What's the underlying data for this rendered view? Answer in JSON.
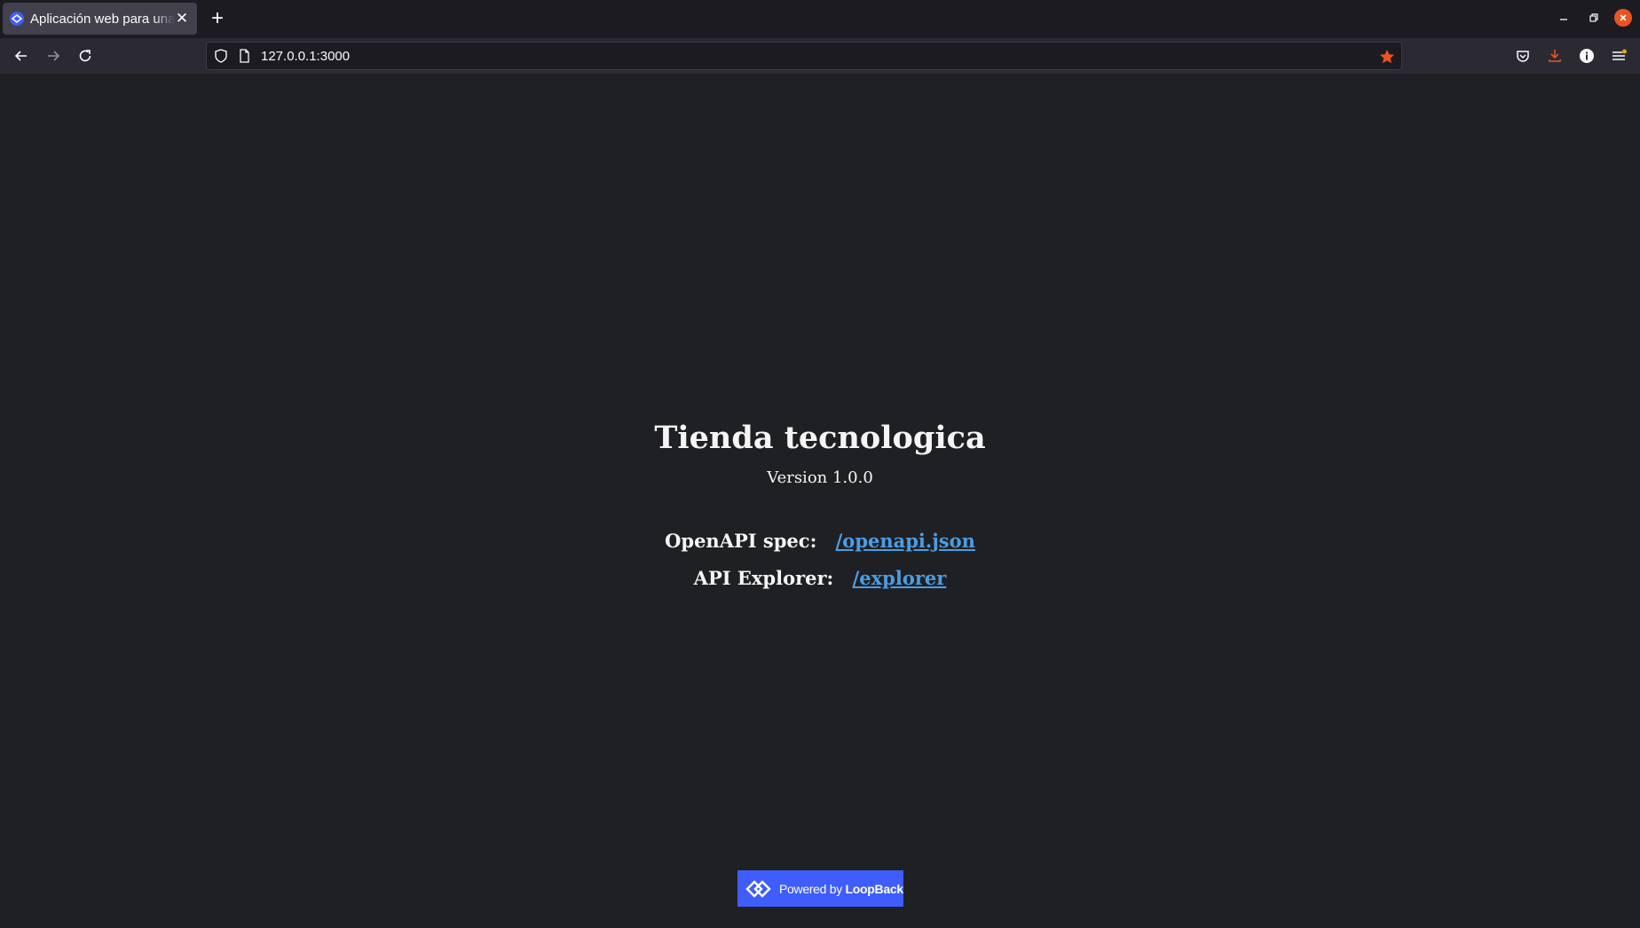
{
  "browser": {
    "tab": {
      "title": "Aplicación web para una tienda tecnologica",
      "close_glyph": "✕",
      "favicon": "loopback-icon"
    },
    "new_tab_glyph": "+",
    "address": "127.0.0.1:3000",
    "icons": {
      "back": "arrow-left-icon",
      "forward": "arrow-right-icon",
      "reload": "reload-icon",
      "shield": "shield-icon",
      "page": "page-icon",
      "bookmark": "star-icon",
      "pocket": "pocket-icon",
      "download": "download-icon",
      "extension": "info-icon",
      "menu": "hamburger-icon"
    },
    "colors": {
      "accent_orange": "#e95420",
      "tab_bg": "#42414d",
      "link": "#4b9de4"
    }
  },
  "app": {
    "title": "Tienda tecnologica",
    "version": "Version 1.0.0",
    "links": [
      {
        "label": "OpenAPI spec:",
        "href_text": "/openapi.json"
      },
      {
        "label": "API Explorer:",
        "href_text": "/explorer"
      }
    ]
  },
  "footer": {
    "powered_prefix": "Powered by",
    "powered_brand": "LoopBack",
    "brand_color": "#3f5dfe"
  }
}
